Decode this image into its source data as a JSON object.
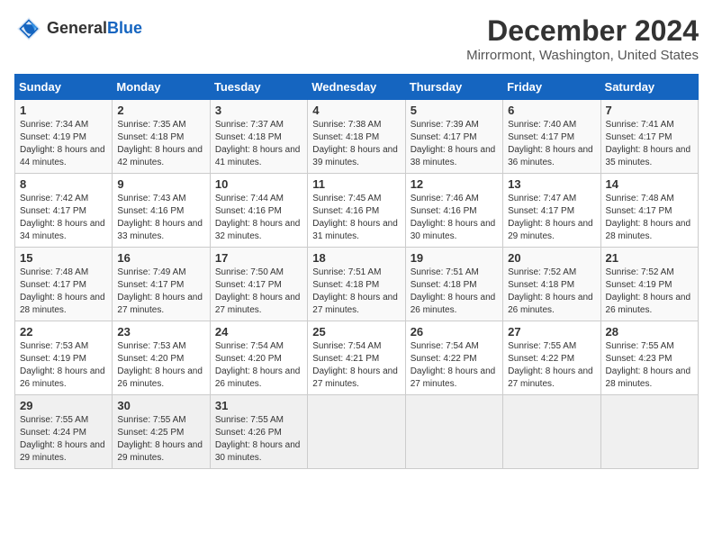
{
  "header": {
    "logo_general": "General",
    "logo_blue": "Blue",
    "month_title": "December 2024",
    "location": "Mirrormont, Washington, United States"
  },
  "days_of_week": [
    "Sunday",
    "Monday",
    "Tuesday",
    "Wednesday",
    "Thursday",
    "Friday",
    "Saturday"
  ],
  "weeks": [
    [
      {
        "day": "1",
        "sunrise": "7:34 AM",
        "sunset": "4:19 PM",
        "daylight": "8 hours and 44 minutes."
      },
      {
        "day": "2",
        "sunrise": "7:35 AM",
        "sunset": "4:18 PM",
        "daylight": "8 hours and 42 minutes."
      },
      {
        "day": "3",
        "sunrise": "7:37 AM",
        "sunset": "4:18 PM",
        "daylight": "8 hours and 41 minutes."
      },
      {
        "day": "4",
        "sunrise": "7:38 AM",
        "sunset": "4:18 PM",
        "daylight": "8 hours and 39 minutes."
      },
      {
        "day": "5",
        "sunrise": "7:39 AM",
        "sunset": "4:17 PM",
        "daylight": "8 hours and 38 minutes."
      },
      {
        "day": "6",
        "sunrise": "7:40 AM",
        "sunset": "4:17 PM",
        "daylight": "8 hours and 36 minutes."
      },
      {
        "day": "7",
        "sunrise": "7:41 AM",
        "sunset": "4:17 PM",
        "daylight": "8 hours and 35 minutes."
      }
    ],
    [
      {
        "day": "8",
        "sunrise": "7:42 AM",
        "sunset": "4:17 PM",
        "daylight": "8 hours and 34 minutes."
      },
      {
        "day": "9",
        "sunrise": "7:43 AM",
        "sunset": "4:16 PM",
        "daylight": "8 hours and 33 minutes."
      },
      {
        "day": "10",
        "sunrise": "7:44 AM",
        "sunset": "4:16 PM",
        "daylight": "8 hours and 32 minutes."
      },
      {
        "day": "11",
        "sunrise": "7:45 AM",
        "sunset": "4:16 PM",
        "daylight": "8 hours and 31 minutes."
      },
      {
        "day": "12",
        "sunrise": "7:46 AM",
        "sunset": "4:16 PM",
        "daylight": "8 hours and 30 minutes."
      },
      {
        "day": "13",
        "sunrise": "7:47 AM",
        "sunset": "4:17 PM",
        "daylight": "8 hours and 29 minutes."
      },
      {
        "day": "14",
        "sunrise": "7:48 AM",
        "sunset": "4:17 PM",
        "daylight": "8 hours and 28 minutes."
      }
    ],
    [
      {
        "day": "15",
        "sunrise": "7:48 AM",
        "sunset": "4:17 PM",
        "daylight": "8 hours and 28 minutes."
      },
      {
        "day": "16",
        "sunrise": "7:49 AM",
        "sunset": "4:17 PM",
        "daylight": "8 hours and 27 minutes."
      },
      {
        "day": "17",
        "sunrise": "7:50 AM",
        "sunset": "4:17 PM",
        "daylight": "8 hours and 27 minutes."
      },
      {
        "day": "18",
        "sunrise": "7:51 AM",
        "sunset": "4:18 PM",
        "daylight": "8 hours and 27 minutes."
      },
      {
        "day": "19",
        "sunrise": "7:51 AM",
        "sunset": "4:18 PM",
        "daylight": "8 hours and 26 minutes."
      },
      {
        "day": "20",
        "sunrise": "7:52 AM",
        "sunset": "4:18 PM",
        "daylight": "8 hours and 26 minutes."
      },
      {
        "day": "21",
        "sunrise": "7:52 AM",
        "sunset": "4:19 PM",
        "daylight": "8 hours and 26 minutes."
      }
    ],
    [
      {
        "day": "22",
        "sunrise": "7:53 AM",
        "sunset": "4:19 PM",
        "daylight": "8 hours and 26 minutes."
      },
      {
        "day": "23",
        "sunrise": "7:53 AM",
        "sunset": "4:20 PM",
        "daylight": "8 hours and 26 minutes."
      },
      {
        "day": "24",
        "sunrise": "7:54 AM",
        "sunset": "4:20 PM",
        "daylight": "8 hours and 26 minutes."
      },
      {
        "day": "25",
        "sunrise": "7:54 AM",
        "sunset": "4:21 PM",
        "daylight": "8 hours and 27 minutes."
      },
      {
        "day": "26",
        "sunrise": "7:54 AM",
        "sunset": "4:22 PM",
        "daylight": "8 hours and 27 minutes."
      },
      {
        "day": "27",
        "sunrise": "7:55 AM",
        "sunset": "4:22 PM",
        "daylight": "8 hours and 27 minutes."
      },
      {
        "day": "28",
        "sunrise": "7:55 AM",
        "sunset": "4:23 PM",
        "daylight": "8 hours and 28 minutes."
      }
    ],
    [
      {
        "day": "29",
        "sunrise": "7:55 AM",
        "sunset": "4:24 PM",
        "daylight": "8 hours and 29 minutes."
      },
      {
        "day": "30",
        "sunrise": "7:55 AM",
        "sunset": "4:25 PM",
        "daylight": "8 hours and 29 minutes."
      },
      {
        "day": "31",
        "sunrise": "7:55 AM",
        "sunset": "4:26 PM",
        "daylight": "8 hours and 30 minutes."
      },
      null,
      null,
      null,
      null
    ]
  ]
}
